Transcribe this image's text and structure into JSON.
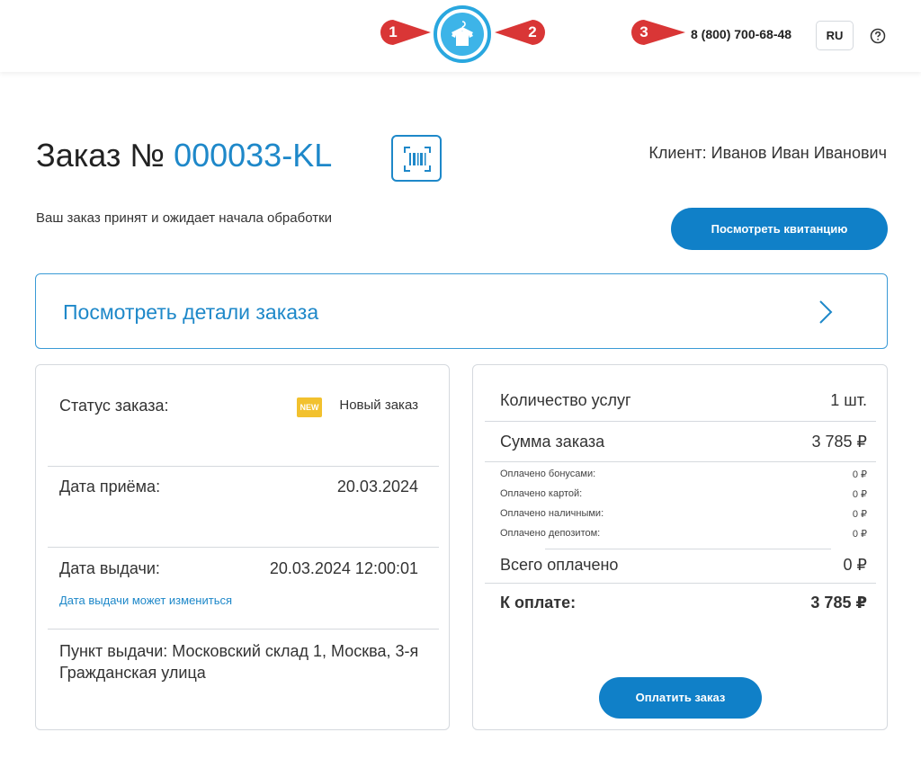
{
  "header": {
    "markers": [
      "1",
      "2",
      "3"
    ],
    "phone": "8 (800) 700-68-48",
    "lang": "RU"
  },
  "order": {
    "title_prefix": "Заказ №",
    "number": "000033-KL",
    "client": "Клиент: Иванов Иван Иванович",
    "status_message": "Ваш заказ принят и ожидает начала обработки",
    "receipt_button": "Посмотреть квитанцию",
    "details_link": "Посмотреть детали заказа"
  },
  "left_card": {
    "status_label": "Статус заказа:",
    "status_badge": "NEW",
    "status_value": "Новый заказ",
    "accept_date_label": "Дата приёма:",
    "accept_date_value": "20.03.2024",
    "issue_date_label": "Дата выдачи:",
    "issue_date_value": "20.03.2024 12:00:01",
    "issue_date_hint": "Дата выдачи может измениться",
    "pickup": "Пункт выдачи: Московский склад 1, Москва, 3-я Гражданская улица"
  },
  "right_card": {
    "services_label": "Количество услуг",
    "services_value": "1 шт.",
    "sum_label": "Сумма заказа",
    "sum_value": "3 785 ₽",
    "paid_bonus_label": "Оплачено бонусами:",
    "paid_bonus_value": "0 ₽",
    "paid_card_label": "Оплачено картой:",
    "paid_card_value": "0 ₽",
    "paid_cash_label": "Оплачено наличными:",
    "paid_cash_value": "0 ₽",
    "paid_deposit_label": "Оплачено депозитом:",
    "paid_deposit_value": "0 ₽",
    "total_paid_label": "Всего оплачено",
    "total_paid_value": "0 ₽",
    "to_pay_label": "К оплате:",
    "to_pay_value": "3 785 ₽",
    "pay_button": "Оплатить заказ"
  },
  "colors": {
    "accent": "#1e88c9",
    "button": "#1080c8",
    "marker": "#e03a3a",
    "badge": "#f2c12e"
  },
  "icons": [
    "logo-shirt-icon",
    "barcode-icon",
    "help-icon",
    "chevron-right-icon"
  ]
}
